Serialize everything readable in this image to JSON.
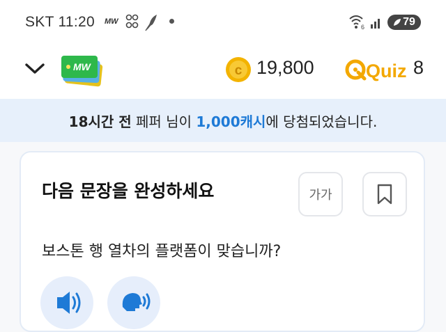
{
  "status_bar": {
    "time": "SKT 11:20",
    "mw_label": "MW",
    "battery": "79"
  },
  "header": {
    "cash_amount": "19,800",
    "quiz_logo_text": "Quiz",
    "quiz_count": "8"
  },
  "banner": {
    "time_ago": "18시간 전",
    "user_text": " 페퍼 님이 ",
    "prize": "1,000캐시",
    "suffix": "에 당첨되었습니다."
  },
  "quiz_card": {
    "title": "다음 문장을 완성하세요",
    "font_size_label": "가가",
    "question": "보스톤 행 열차의 플랫폼이 맞습니까?"
  },
  "colors": {
    "accent_blue": "#1e7ad6",
    "coin_gold": "#f3b300",
    "banner_bg": "#e7f0fb",
    "logo_green": "#2eb84b"
  },
  "icons": [
    "chevron-down-icon",
    "mw-logo-icon",
    "coin-icon",
    "quiz-logo-icon",
    "bookmark-icon",
    "speaker-icon",
    "speak-icon",
    "wifi-icon",
    "signal-icon"
  ]
}
